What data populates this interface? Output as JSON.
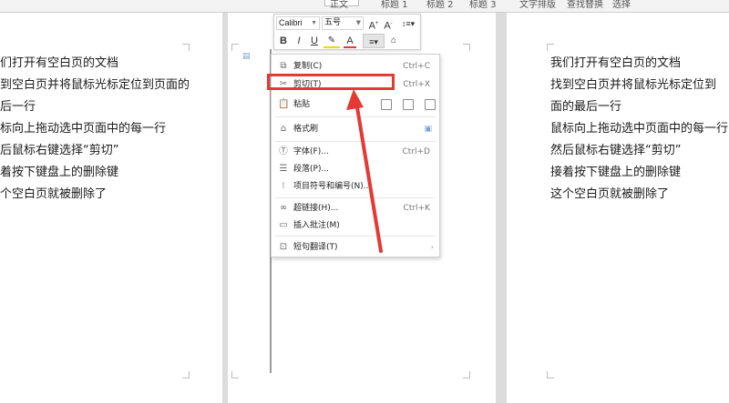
{
  "ribbon": {
    "items": [
      "正文",
      "标题 1",
      "标题 2",
      "标题 3",
      "文字排版",
      "查找替换",
      "选择"
    ]
  },
  "left_page": {
    "lines": [
      "们打开有空白页的文档",
      "到空白页并将鼠标光标定位到页面的",
      "后一行",
      "标向上拖动选中页面中的每一行",
      "后鼠标右键选择“剪切”",
      "着按下键盘上的删除键",
      "个空白页就被删除了"
    ]
  },
  "right_page": {
    "lines": [
      "我们打开有空白页的文档",
      "找到空白页并将鼠标光标定位到",
      "面的最后一行",
      "鼠标向上拖动选中页面中的每一行",
      "然后鼠标右键选择“剪切”",
      "接着按下键盘上的删除键",
      "这个空白页就被删除了"
    ]
  },
  "mini_toolbar": {
    "font_name": "Calibri",
    "font_size": "五号",
    "bold": "B",
    "italic": "I",
    "underline": "U",
    "font_color": "A"
  },
  "context_menu": {
    "items": [
      {
        "label": "复制(C)",
        "shortcut": "Ctrl+C"
      },
      {
        "label": "剪切(T)",
        "shortcut": "Ctrl+X"
      },
      {
        "label": "粘贴",
        "shortcut": ""
      },
      {
        "label": "格式刷",
        "shortcut": ""
      },
      {
        "label": "字体(F)...",
        "shortcut": "Ctrl+D"
      },
      {
        "label": "段落(P)...",
        "shortcut": ""
      },
      {
        "label": "项目符号和编号(N)...",
        "shortcut": ""
      },
      {
        "label": "超链接(H)...",
        "shortcut": "Ctrl+K"
      },
      {
        "label": "插入批注(M)",
        "shortcut": ""
      },
      {
        "label": "短句翻译(T)",
        "shortcut": ""
      }
    ]
  },
  "colors": {
    "highlight": "#e53935",
    "arrow": "#e53935"
  }
}
